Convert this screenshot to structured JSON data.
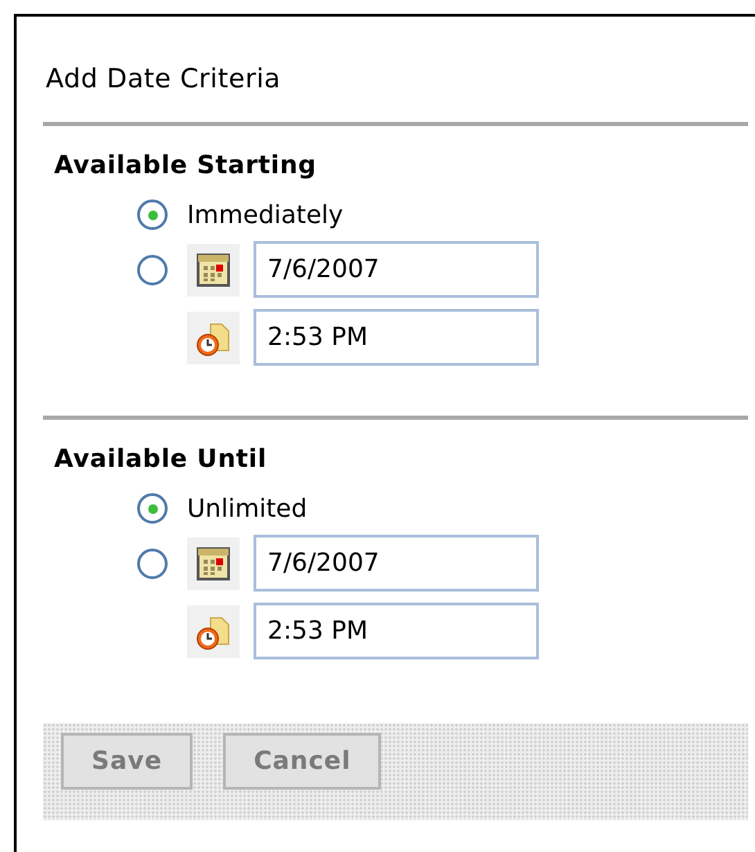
{
  "title": "Add Date Criteria",
  "sections": [
    {
      "heading": "Available Starting",
      "options": [
        {
          "kind": "text",
          "label": "Immediately",
          "selected": true
        },
        {
          "kind": "datetime",
          "date": "7/6/2007",
          "time": "2:53 PM",
          "selected": false
        }
      ]
    },
    {
      "heading": "Available Until",
      "options": [
        {
          "kind": "text",
          "label": "Unlimited",
          "selected": true
        },
        {
          "kind": "datetime",
          "date": "7/6/2007",
          "time": "2:53 PM",
          "selected": false
        }
      ]
    }
  ],
  "buttons": [
    "Save",
    "Cancel"
  ]
}
